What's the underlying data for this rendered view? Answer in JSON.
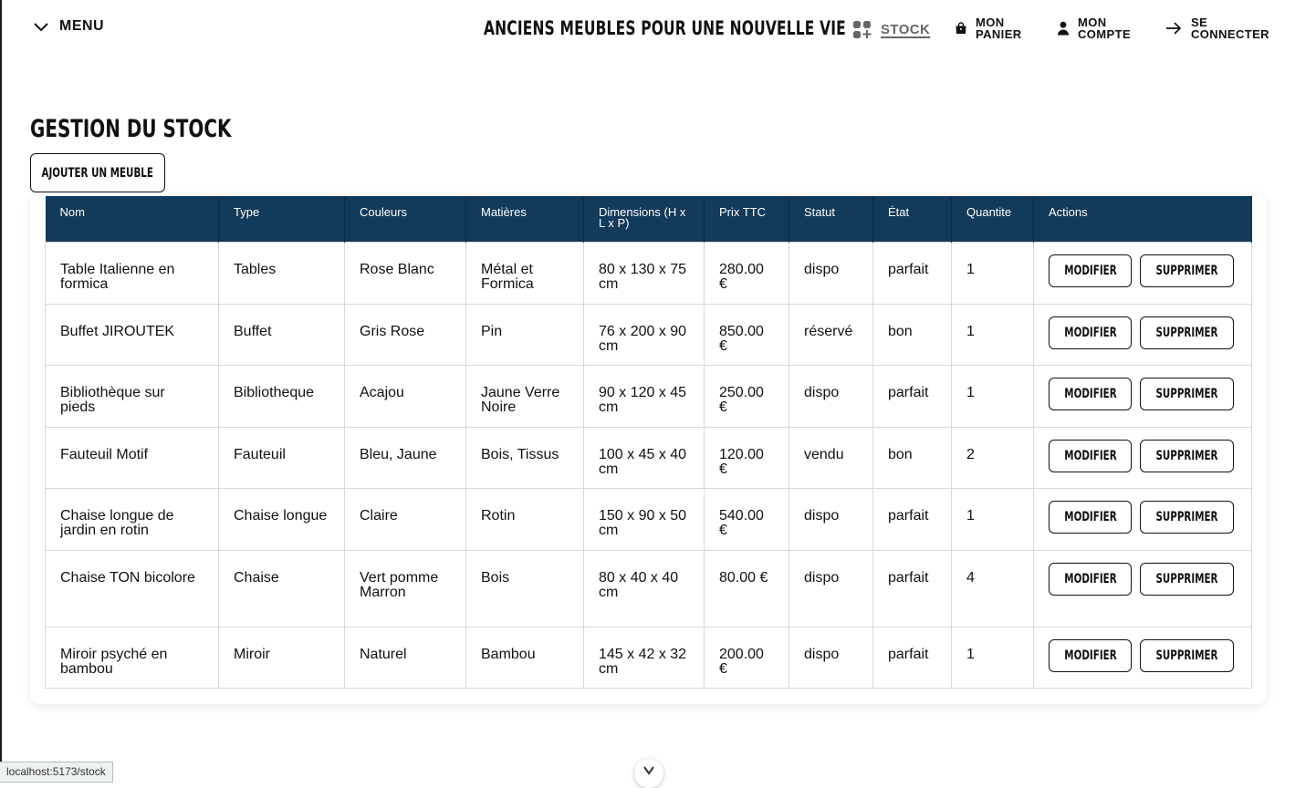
{
  "header": {
    "menu_label": "MENU",
    "site_title": "ANCIENS MEUBLES POUR UNE NOUVELLE VIE",
    "nav": {
      "stock": "STOCK",
      "cart_line1": "MON",
      "cart_line2": "PANIER",
      "account_line1": "MON",
      "account_line2": "COMPTE",
      "login_line1": "SE",
      "login_line2": "CONNECTER"
    }
  },
  "page": {
    "title": "GESTION DU STOCK",
    "add_button": "AJOUTER UN MEUBLE"
  },
  "table": {
    "columns": [
      "Nom",
      "Type",
      "Couleurs",
      "Matières",
      "Dimensions (H x L x P)",
      "Prix TTC",
      "Statut",
      "État",
      "Quantite",
      "Actions"
    ],
    "action_labels": {
      "edit": "MODIFIER",
      "delete": "SUPPRIMER"
    },
    "rows": [
      {
        "nom": "Table Italienne en formica",
        "type": "Tables",
        "couleurs": "Rose Blanc",
        "matieres": "Métal et Formica",
        "dimensions": "80 x 130 x 75 cm",
        "prix": "280.00 €",
        "statut": "dispo",
        "etat": "parfait",
        "quantite": "1"
      },
      {
        "nom": "Buffet JIROUTEK",
        "type": "Buffet",
        "couleurs": "Gris Rose",
        "matieres": "Pin",
        "dimensions": "76 x 200 x 90 cm",
        "prix": "850.00 €",
        "statut": "réservé",
        "etat": "bon",
        "quantite": "1"
      },
      {
        "nom": "Bibliothèque sur pieds",
        "type": "Bibliotheque",
        "couleurs": "Acajou",
        "matieres": "Jaune Verre Noire",
        "dimensions": "90 x 120 x 45 cm",
        "prix": "250.00 €",
        "statut": "dispo",
        "etat": "parfait",
        "quantite": "1"
      },
      {
        "nom": "Fauteuil Motif",
        "type": "Fauteuil",
        "couleurs": "Bleu, Jaune",
        "matieres": "Bois, Tissus",
        "dimensions": "100 x 45 x 40 cm",
        "prix": "120.00 €",
        "statut": "vendu",
        "etat": "bon",
        "quantite": "2"
      },
      {
        "nom": "Chaise longue de jardin en rotin",
        "type": "Chaise longue",
        "couleurs": "Claire",
        "matieres": "Rotin",
        "dimensions": "150 x 90 x 50 cm",
        "prix": "540.00 €",
        "statut": "dispo",
        "etat": "parfait",
        "quantite": "1"
      },
      {
        "nom": "Chaise TON bicolore",
        "type": "Chaise",
        "couleurs": "Vert pomme Marron",
        "matieres": "Bois",
        "dimensions": "80 x 40 x 40 cm",
        "prix": "80.00 €",
        "statut": "dispo",
        "etat": "parfait",
        "quantite": "4"
      },
      {
        "nom": "Miroir psyché en bambou",
        "type": "Miroir",
        "couleurs": "Naturel",
        "matieres": "Bambou",
        "dimensions": "145 x 42 x 32 cm",
        "prix": "200.00 €",
        "statut": "dispo",
        "etat": "parfait",
        "quantite": "1"
      }
    ]
  },
  "status_bar": {
    "url": "localhost:5173/stock"
  },
  "icons": {
    "menu": "chevron-down-icon",
    "stock": "grid-plus-icon",
    "cart": "shopping-bag-icon",
    "account": "user-icon",
    "login": "arrow-right-icon",
    "scroll": "chevron-down-icon"
  },
  "colors": {
    "table_header_bg": "#123a5a",
    "text": "#111111"
  }
}
